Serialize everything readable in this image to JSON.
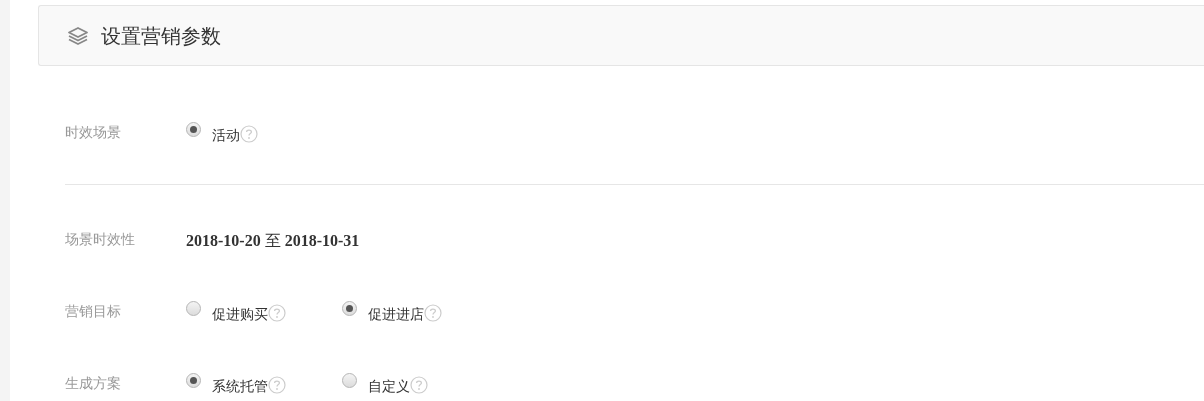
{
  "header": {
    "title": "设置营销参数"
  },
  "sections": [
    {
      "rows": [
        {
          "kind": "radio",
          "label": "时效场景",
          "options": [
            {
              "label": "活动",
              "selected": true,
              "help": true
            }
          ]
        }
      ]
    },
    {
      "rows": [
        {
          "kind": "text",
          "label": "场景时效性",
          "value": "**2018-10-20** 至 **2018-10-31**"
        },
        {
          "kind": "radio",
          "label": "营销目标",
          "options": [
            {
              "label": "促进购买",
              "selected": false,
              "help": true
            },
            {
              "label": "促进进店",
              "selected": true,
              "help": true
            }
          ]
        },
        {
          "kind": "radio",
          "label": "生成方案",
          "options": [
            {
              "label": "系统托管",
              "selected": true,
              "help": true
            },
            {
              "label": "自定义",
              "selected": false,
              "help": true
            }
          ]
        }
      ]
    }
  ]
}
